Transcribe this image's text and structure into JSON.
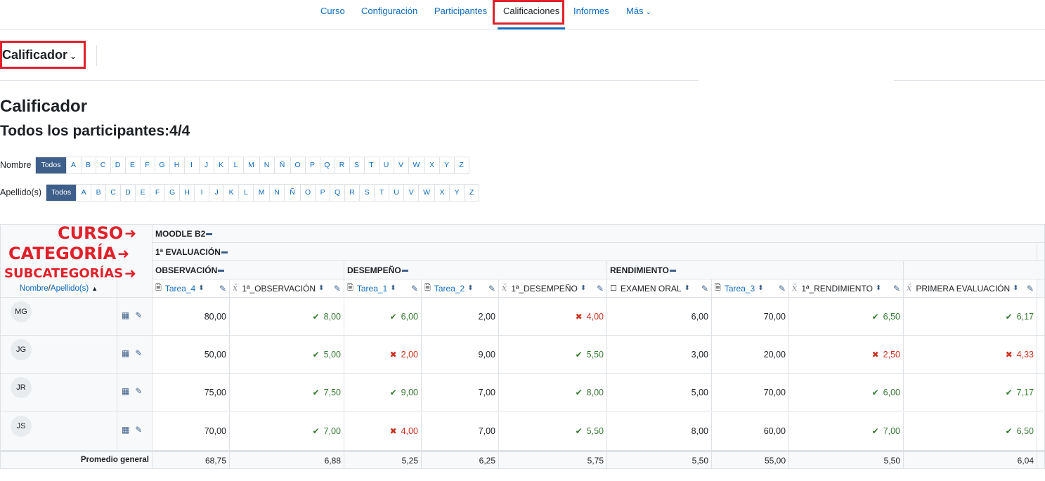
{
  "nav": {
    "tabs": [
      "Curso",
      "Configuración",
      "Participantes",
      "Calificaciones",
      "Informes",
      "Más"
    ],
    "active": "Calificaciones"
  },
  "report_selector": "Calificador",
  "page_title": "Calificador",
  "subtitle": "Todos los participantes:4/4",
  "initials": {
    "first_label": "Nombre",
    "last_label": "Apellido(s)",
    "all_label": "Todos",
    "letters": [
      "A",
      "B",
      "C",
      "D",
      "E",
      "F",
      "G",
      "H",
      "I",
      "J",
      "K",
      "L",
      "M",
      "N",
      "Ñ",
      "O",
      "P",
      "Q",
      "R",
      "S",
      "T",
      "U",
      "V",
      "W",
      "X",
      "Y",
      "Z"
    ]
  },
  "annotations": {
    "course": "CURSO",
    "category": "CATEGORÍA",
    "subcategories": "SUBCATEGORÍAS"
  },
  "table": {
    "course_name": "MOODLE B2",
    "category_name": "1ª EVALUACIÓN",
    "subcategories": [
      "OBSERVACIÓN",
      "DESEMPEÑO",
      "RENDIMIENTO"
    ],
    "name_header": "Nombre",
    "name_header_sep": " / ",
    "surname_header": "Apellido(s)",
    "columns": [
      {
        "name": "Tarea_4",
        "type": "assign"
      },
      {
        "name": "1ª_OBSERVACIÓN",
        "type": "total"
      },
      {
        "name": "Tarea_1",
        "type": "assign"
      },
      {
        "name": "Tarea_2",
        "type": "assign"
      },
      {
        "name": "1ª_DESEMPEÑO",
        "type": "total"
      },
      {
        "name": "EXAMEN ORAL",
        "type": "manual"
      },
      {
        "name": "Tarea_3",
        "type": "assign"
      },
      {
        "name": "1ª_RENDIMIENTO",
        "type": "total"
      },
      {
        "name": "PRIMERA EVALUACIÓN",
        "type": "total"
      }
    ],
    "rows": [
      {
        "initials": "MG",
        "cells": [
          {
            "v": "80,00"
          },
          {
            "v": "8,00",
            "s": "pass"
          },
          {
            "v": "6,00",
            "s": "pass"
          },
          {
            "v": "2,00"
          },
          {
            "v": "4,00",
            "s": "fail"
          },
          {
            "v": "6,00"
          },
          {
            "v": "70,00"
          },
          {
            "v": "6,50",
            "s": "pass"
          },
          {
            "v": "6,17",
            "s": "pass"
          }
        ]
      },
      {
        "initials": "JG",
        "cells": [
          {
            "v": "50,00"
          },
          {
            "v": "5,00",
            "s": "pass"
          },
          {
            "v": "2,00",
            "s": "fail"
          },
          {
            "v": "9,00"
          },
          {
            "v": "5,50",
            "s": "pass"
          },
          {
            "v": "3,00"
          },
          {
            "v": "20,00"
          },
          {
            "v": "2,50",
            "s": "fail"
          },
          {
            "v": "4,33",
            "s": "fail"
          }
        ]
      },
      {
        "initials": "JR",
        "cells": [
          {
            "v": "75,00"
          },
          {
            "v": "7,50",
            "s": "pass"
          },
          {
            "v": "9,00",
            "s": "pass"
          },
          {
            "v": "7,00"
          },
          {
            "v": "8,00",
            "s": "pass"
          },
          {
            "v": "5,00"
          },
          {
            "v": "70,00"
          },
          {
            "v": "6,00",
            "s": "pass"
          },
          {
            "v": "7,17",
            "s": "pass"
          }
        ]
      },
      {
        "initials": "JS",
        "cells": [
          {
            "v": "70,00"
          },
          {
            "v": "7,00",
            "s": "pass"
          },
          {
            "v": "4,00",
            "s": "fail"
          },
          {
            "v": "7,00"
          },
          {
            "v": "5,50",
            "s": "pass"
          },
          {
            "v": "8,00"
          },
          {
            "v": "60,00"
          },
          {
            "v": "7,00",
            "s": "pass"
          },
          {
            "v": "6,50",
            "s": "pass"
          }
        ]
      }
    ],
    "average_label": "Promedio general",
    "averages": [
      "68,75",
      "6,88",
      "5,25",
      "6,25",
      "5,75",
      "5,50",
      "55,00",
      "5,50",
      "6,04"
    ]
  },
  "colors": {
    "link": "#0f6cbf",
    "pass": "#357a32",
    "fail": "#ca3120",
    "annotation": "#e0202a",
    "todos_bg": "#3e5f8a"
  }
}
